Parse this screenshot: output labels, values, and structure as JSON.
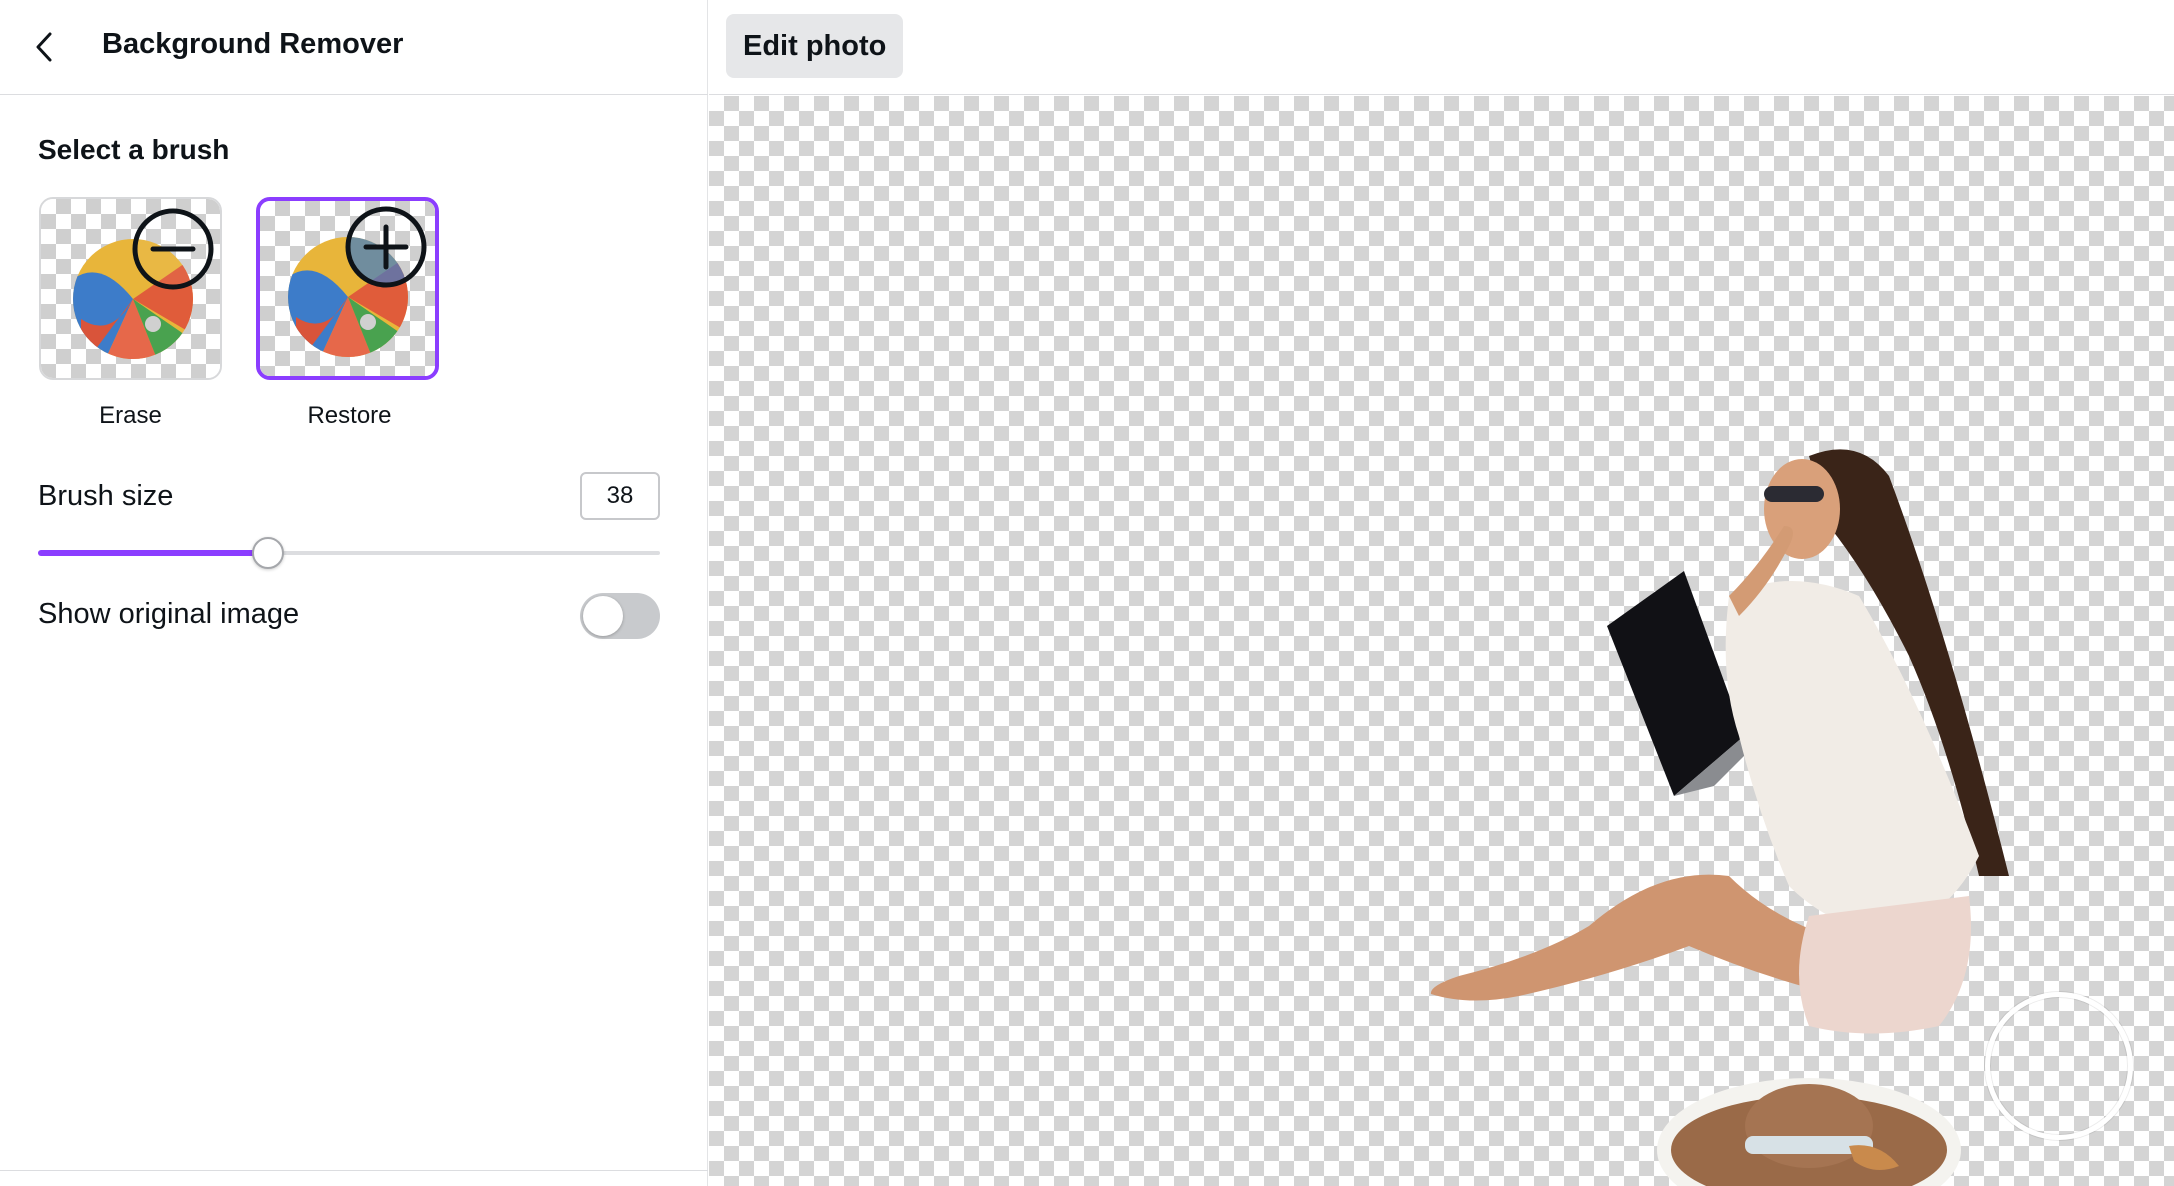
{
  "panel": {
    "title": "Background Remover",
    "back_icon": "chevron-left-icon",
    "section_title": "Select a brush",
    "brushes": [
      {
        "label": "Erase",
        "icon": "minus-circle-icon",
        "selected": false
      },
      {
        "label": "Restore",
        "icon": "plus-circle-icon",
        "selected": true
      }
    ],
    "brush_size": {
      "label": "Brush size",
      "value": "38",
      "slider_fraction": 0.37
    },
    "show_original": {
      "label": "Show original image",
      "enabled": false
    }
  },
  "toolbar": {
    "edit_photo_label": "Edit photo"
  },
  "colors": {
    "accent": "#8b3dff",
    "checker": "#d4d4d4"
  }
}
